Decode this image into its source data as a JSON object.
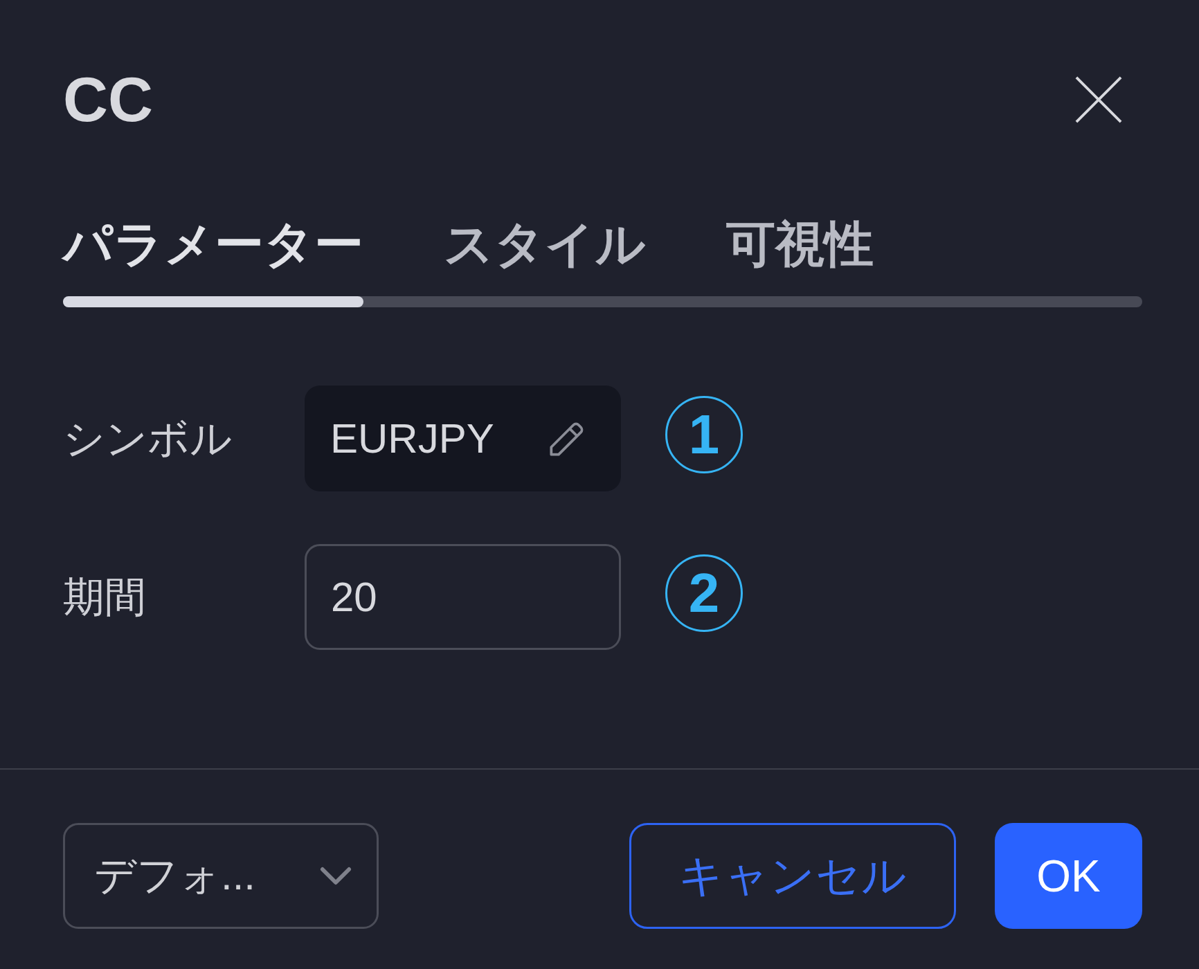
{
  "dialog": {
    "title": "CC"
  },
  "tabs": [
    {
      "label": "パラメーター",
      "selected": true
    },
    {
      "label": "スタイル",
      "selected": false
    },
    {
      "label": "可視性",
      "selected": false
    }
  ],
  "fields": [
    {
      "kind": "symbol",
      "label": "シンボル",
      "value": "EURJPY",
      "marker": "1"
    },
    {
      "kind": "number",
      "label": "期間",
      "value": "20",
      "marker": "2"
    }
  ],
  "footer": {
    "template_dropdown": {
      "value": "デフォ..."
    },
    "buttons": [
      {
        "kind": "secondary",
        "label": "キャンセル"
      },
      {
        "kind": "primary",
        "label": "OK"
      }
    ]
  }
}
